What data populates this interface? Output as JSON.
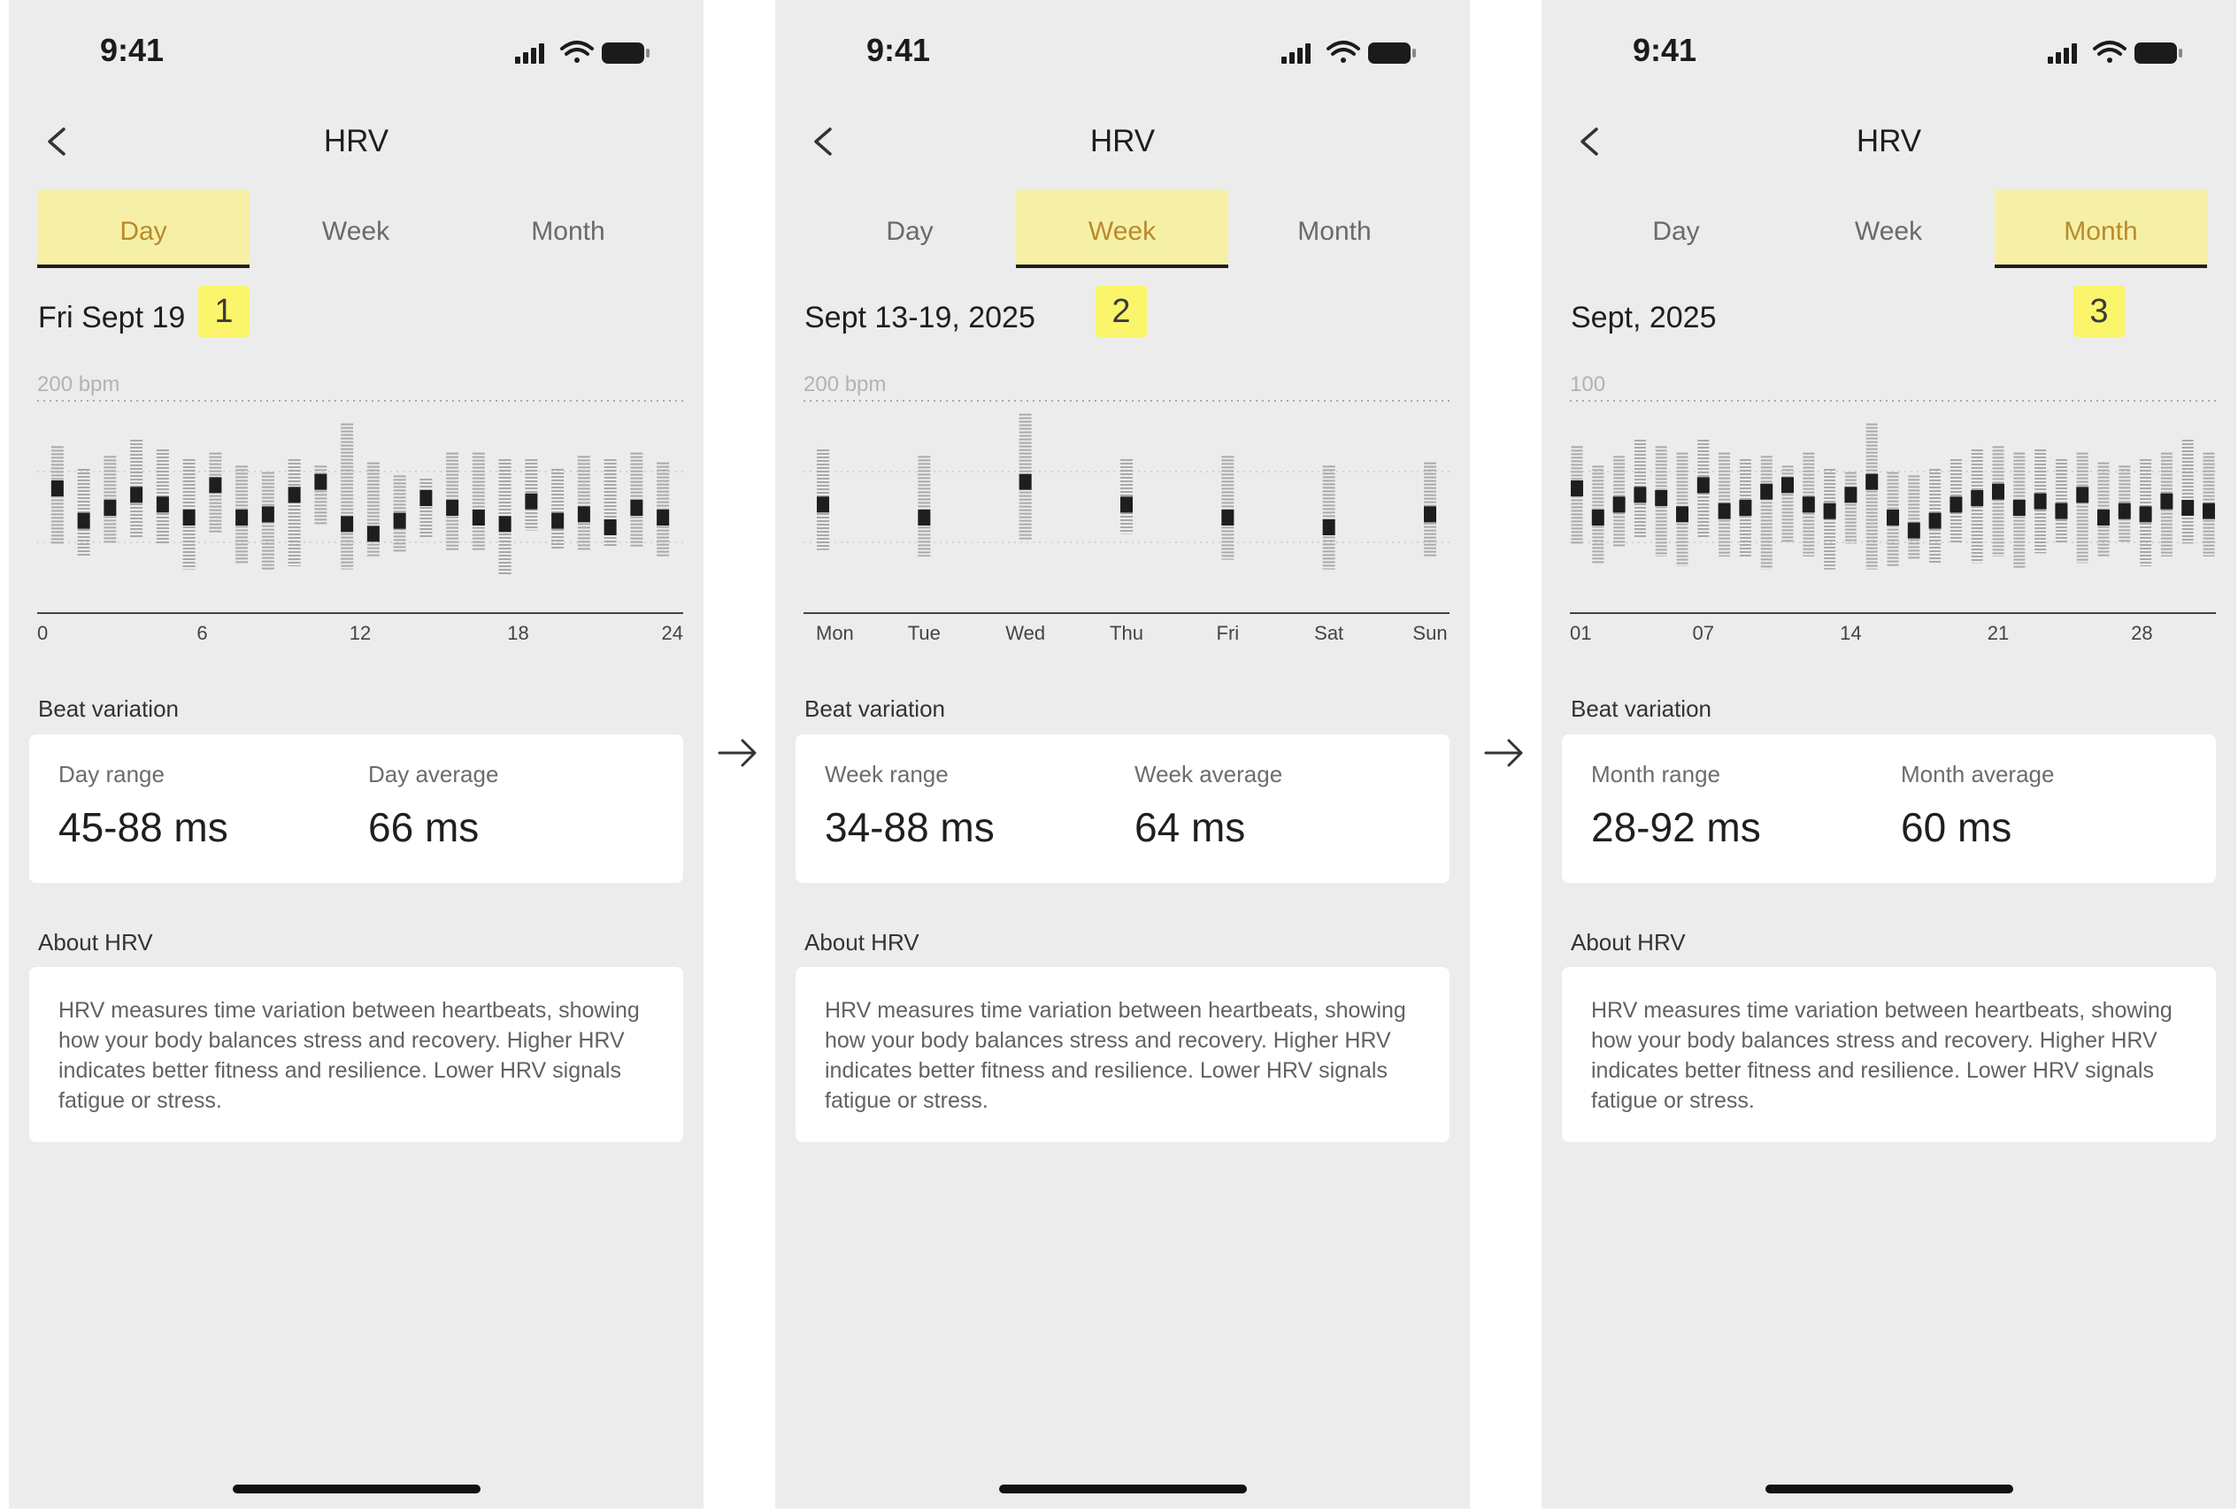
{
  "colors": {
    "screen_bg": "#ececec",
    "active_tab_bg": "#f6f0a6",
    "active_tab_text": "#b98a2c",
    "step_badge": "#faf56b",
    "card_bg": "#ffffff"
  },
  "icons": [
    "signal-icon",
    "wifi-icon",
    "battery-icon",
    "back-chevron-icon",
    "arrow-right-icon"
  ],
  "screens": [
    {
      "status_time": "9:41",
      "title": "HRV",
      "tabs": [
        {
          "label": "Day",
          "active": true
        },
        {
          "label": "Week",
          "active": false
        },
        {
          "label": "Month",
          "active": false
        }
      ],
      "period": "Fri Sept 19",
      "step": "1",
      "chart_unit": "200 bpm",
      "x_ticks": [
        "0",
        "6",
        "12",
        "18",
        "24"
      ],
      "variation_heading": "Beat variation",
      "range_label": "Day range",
      "range_value": "45-88 ms",
      "average_label": "Day average",
      "average_value": "66 ms",
      "about_heading": "About HRV",
      "about_text": "HRV measures time variation between heartbeats, showing how your body balances stress and recovery. Higher HRV indicates better fitness and resilience. Lower HRV signals fatigue or stress."
    },
    {
      "status_time": "9:41",
      "title": "HRV",
      "tabs": [
        {
          "label": "Day",
          "active": false
        },
        {
          "label": "Week",
          "active": true
        },
        {
          "label": "Month",
          "active": false
        }
      ],
      "period": "Sept 13-19, 2025",
      "step": "2",
      "chart_unit": "200 bpm",
      "x_ticks": [
        "Mon",
        "Tue",
        "Wed",
        "Thu",
        "Fri",
        "Sat",
        "Sun"
      ],
      "variation_heading": "Beat variation",
      "range_label": "Week range",
      "range_value": "34-88 ms",
      "average_label": "Week average",
      "average_value": "64 ms",
      "about_heading": "About HRV",
      "about_text": "HRV measures time variation between heartbeats, showing how your body balances stress and recovery. Higher HRV indicates better fitness and resilience. Lower HRV signals fatigue or stress."
    },
    {
      "status_time": "9:41",
      "title": "HRV",
      "tabs": [
        {
          "label": "Day",
          "active": false
        },
        {
          "label": "Week",
          "active": false
        },
        {
          "label": "Month",
          "active": true
        }
      ],
      "period": "Sept, 2025",
      "step": "3",
      "chart_unit": "100",
      "x_ticks": [
        "01",
        "07",
        "14",
        "21",
        "28"
      ],
      "variation_heading": "Beat variation",
      "range_label": "Month range",
      "range_value": "28-92 ms",
      "average_label": "Month average",
      "average_value": "60 ms",
      "about_heading": "About HRV",
      "about_text": "HRV measures time variation between heartbeats, showing how your body balances stress and recovery. Higher HRV indicates better fitness and resilience. Lower HRV signals fatigue or stress."
    }
  ],
  "chart_data": [
    {
      "type": "range-dot",
      "xlabel": "",
      "ylabel": "",
      "x": [
        0.5,
        1.5,
        2.5,
        3.5,
        4.5,
        5.5,
        6.5,
        7.5,
        8.5,
        9.5,
        10.5,
        11.5,
        12.5,
        13.5,
        14.5,
        15.5,
        16.5,
        17.5,
        18.5,
        19.5,
        20.5,
        21.5,
        22.5,
        23.5
      ],
      "x_ticks": [
        0,
        6,
        12,
        18,
        24
      ],
      "series": [
        {
          "low": [
            112,
            104,
            112,
            116,
            112,
            96,
            118,
            100,
            96,
            98,
            124,
            96,
            104,
            106,
            116,
            108,
            108,
            92,
            120,
            108,
            108,
            110,
            110,
            104
          ],
          "high": [
            172,
            158,
            166,
            176,
            170,
            164,
            168,
            160,
            156,
            164,
            160,
            186,
            162,
            154,
            152,
            168,
            168,
            164,
            164,
            158,
            166,
            164,
            168,
            162
          ],
          "mid": [
            146,
            126,
            134,
            142,
            136,
            128,
            148,
            128,
            130,
            142,
            150,
            124,
            118,
            126,
            140,
            134,
            128,
            124,
            138,
            126,
            130,
            122,
            134,
            128
          ]
        }
      ],
      "ylim": [
        80,
        200
      ]
    },
    {
      "type": "range-dot",
      "xlabel": "",
      "ylabel": "",
      "categories": [
        "Mon",
        "Tue",
        "Wed",
        "Thu",
        "Fri",
        "Sat",
        "Sun"
      ],
      "series": [
        {
          "low": [
            108,
            104,
            114,
            118,
            102,
            96,
            104
          ],
          "high": [
            170,
            166,
            192,
            164,
            166,
            160,
            162
          ],
          "mid": [
            136,
            128,
            150,
            136,
            128,
            122,
            130
          ]
        }
      ],
      "ylim": [
        80,
        200
      ]
    },
    {
      "type": "range-dot",
      "xlabel": "",
      "ylabel": "",
      "x": [
        1,
        2,
        3,
        4,
        5,
        6,
        7,
        8,
        9,
        10,
        11,
        12,
        13,
        14,
        15,
        16,
        17,
        18,
        19,
        20,
        21,
        22,
        23,
        24,
        25,
        26,
        27,
        28,
        29,
        30,
        31
      ],
      "x_ticks": [
        "01",
        "07",
        "14",
        "21",
        "28"
      ],
      "series": [
        {
          "low": [
            56,
            50,
            55,
            58,
            52,
            49,
            58,
            52,
            52,
            48,
            56,
            52,
            48,
            56,
            48,
            49,
            51,
            50,
            56,
            50,
            52,
            48,
            53,
            56,
            50,
            52,
            56,
            49,
            52,
            56,
            52
          ],
          "high": [
            86,
            80,
            83,
            88,
            86,
            84,
            88,
            84,
            82,
            83,
            80,
            84,
            79,
            78,
            93,
            78,
            77,
            79,
            82,
            85,
            86,
            84,
            85,
            82,
            84,
            81,
            80,
            82,
            84,
            88,
            84
          ],
          "mid": [
            73,
            64,
            68,
            71,
            70,
            65,
            74,
            66,
            67,
            72,
            74,
            68,
            66,
            71,
            75,
            64,
            60,
            63,
            68,
            70,
            72,
            67,
            69,
            66,
            71,
            64,
            66,
            65,
            69,
            67,
            66
          ]
        }
      ],
      "ylim": [
        40,
        100
      ]
    }
  ]
}
